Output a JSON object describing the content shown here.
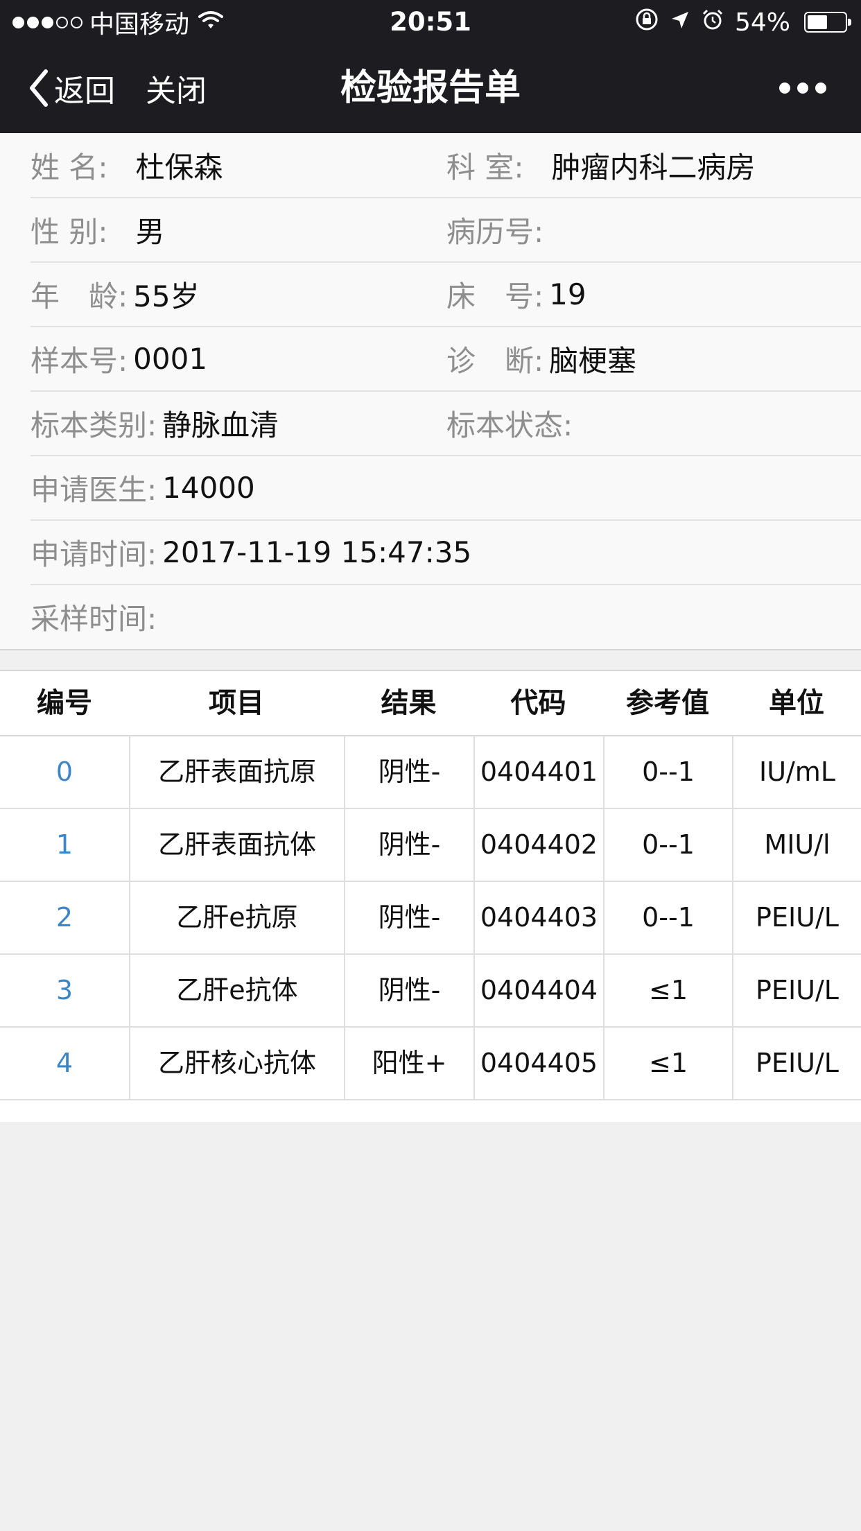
{
  "status_bar": {
    "carrier": "中国移动",
    "time": "20:51",
    "battery": "54%",
    "battery_level": 0.54,
    "icons": [
      "signal-dots",
      "wifi-icon",
      "rotation-lock-icon",
      "location-arrow-icon",
      "alarm-icon",
      "battery-icon"
    ]
  },
  "nav": {
    "back_label": "返回",
    "close_label": "关闭",
    "title": "检验报告单",
    "more_icon": "more-dots-icon"
  },
  "info": {
    "name": {
      "label": "姓 名:",
      "value": "杜保森"
    },
    "department": {
      "label": "科 室:",
      "value": "肿瘤内科二病房"
    },
    "gender": {
      "label": "性 别:",
      "value": "男"
    },
    "record_no": {
      "label": "病历号:",
      "value": ""
    },
    "age": {
      "label": "年　龄:",
      "value": "55岁"
    },
    "bed": {
      "label": "床　号:",
      "value": "19"
    },
    "sample_no": {
      "label": "样本号:",
      "value": "0001"
    },
    "diagnosis": {
      "label": "诊　断:",
      "value": "脑梗塞"
    },
    "specimen_type": {
      "label": "标本类别:",
      "value": "静脉血清"
    },
    "specimen_status": {
      "label": "标本状态:",
      "value": ""
    },
    "doctor": {
      "label": "申请医生:",
      "value": "14000"
    },
    "request_time": {
      "label": "申请时间:",
      "value": "2017-11-19 15:47:35"
    },
    "sample_time": {
      "label": "采样时间:",
      "value": ""
    }
  },
  "table": {
    "headers": [
      "编号",
      "项目",
      "结果",
      "代码",
      "参考值",
      "单位"
    ],
    "rows": [
      [
        "0",
        "乙肝表面抗原",
        "阴性-",
        "0404401",
        "0--1",
        "IU/mL"
      ],
      [
        "1",
        "乙肝表面抗体",
        "阴性-",
        "0404402",
        "0--1",
        "MIU/l"
      ],
      [
        "2",
        "乙肝e抗原",
        "阴性-",
        "0404403",
        "0--1",
        "PEIU/L"
      ],
      [
        "3",
        "乙肝e抗体",
        "阴性-",
        "0404404",
        "≤1",
        "PEIU/L"
      ],
      [
        "4",
        "乙肝核心抗体",
        "阳性+",
        "0404405",
        "≤1",
        "PEIU/L"
      ]
    ]
  },
  "colors": {
    "nav_background": "#1c1c21",
    "row_number": "#3d86c6",
    "label_gray": "#8e8e8e"
  }
}
